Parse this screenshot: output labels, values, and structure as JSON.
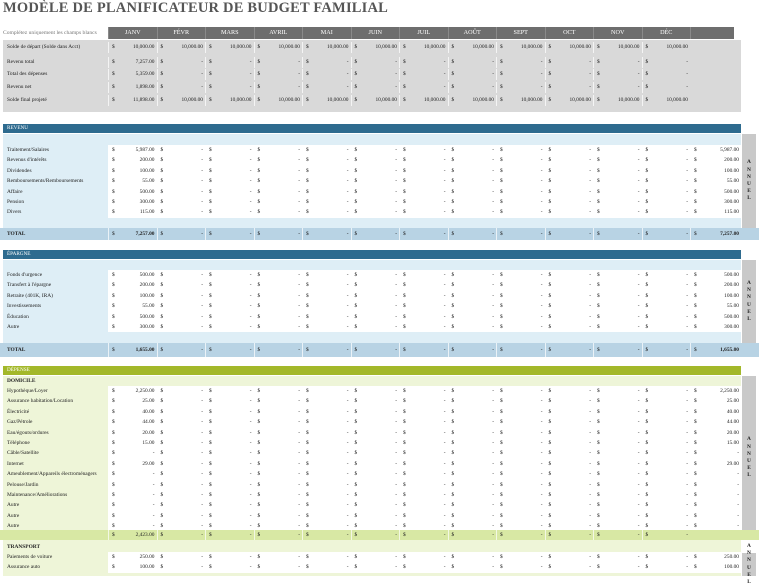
{
  "title": "MODÈLE DE PLANIFICATEUR DE BUDGET FAMILIAL",
  "hint": "Complétez uniquement les champs blancs",
  "months": [
    "JANV",
    "FÉVR",
    "MARS",
    "AVRIL",
    "MAI",
    "JUIN",
    "JUIL",
    "AOÛT",
    "SEPT",
    "OCT",
    "NOV",
    "DÉC"
  ],
  "currency": "$",
  "dash": "-",
  "annual_word": "ANNUEL",
  "summary": [
    {
      "label": "Solde de départ (Solde dans Acct)",
      "values": [
        "10,000.00",
        "10,000.00",
        "10,000.00",
        "10,000.00",
        "10,000.00",
        "10,000.00",
        "10,000.00",
        "10,000.00",
        "10,000.00",
        "10,000.00",
        "10,000.00",
        "10,000.00"
      ]
    },
    {
      "label": "Revenu total",
      "values": [
        "7,257.00",
        "-",
        "-",
        "-",
        "-",
        "-",
        "-",
        "-",
        "-",
        "-",
        "-",
        "-"
      ]
    },
    {
      "label": "Total des dépenses",
      "values": [
        "5,359.00",
        "-",
        "-",
        "-",
        "-",
        "-",
        "-",
        "-",
        "-",
        "-",
        "-",
        "-"
      ]
    },
    {
      "label": "Revenu net",
      "values": [
        "1,898.00",
        "-",
        "-",
        "-",
        "-",
        "-",
        "-",
        "-",
        "-",
        "-",
        "-",
        "-"
      ]
    },
    {
      "label": "Solde final projeté",
      "values": [
        "11,898.00",
        "10,000.00",
        "10,000.00",
        "10,000.00",
        "10,000.00",
        "10,000.00",
        "10,000.00",
        "10,000.00",
        "10,000.00",
        "10,000.00",
        "10,000.00",
        "10,000.00"
      ]
    }
  ],
  "revenu": {
    "header": "REVENU",
    "color": "#2e6b8f",
    "rows": [
      {
        "label": "Traitement/Salaires",
        "jan": "5,987.00",
        "annual": "5,987.00"
      },
      {
        "label": "Revenus d'intérêts",
        "jan": "200.00",
        "annual": "200.00"
      },
      {
        "label": "Dividendes",
        "jan": "100.00",
        "annual": "100.00"
      },
      {
        "label": "Remboursements/Remboursements",
        "jan": "55.00",
        "annual": "55.00"
      },
      {
        "label": "Affaire",
        "jan": "500.00",
        "annual": "500.00"
      },
      {
        "label": "Pension",
        "jan": "300.00",
        "annual": "300.00"
      },
      {
        "label": "Divers",
        "jan": "115.00",
        "annual": "115.00"
      }
    ],
    "total_label": "TOTAL",
    "total_jan": "7,257.00",
    "total_annual": "7,257.00"
  },
  "epargne": {
    "header": "ÉPARGNE",
    "color": "#2e6b8f",
    "rows": [
      {
        "label": "Fonds d'urgence",
        "jan": "500.00",
        "annual": "500.00"
      },
      {
        "label": "Transfert à l'épargne",
        "jan": "200.00",
        "annual": "200.00"
      },
      {
        "label": "Retraite (401K, IRA)",
        "jan": "100.00",
        "annual": "100.00"
      },
      {
        "label": "Investissements",
        "jan": "55.00",
        "annual": "55.00"
      },
      {
        "label": "Éducation",
        "jan": "500.00",
        "annual": "500.00"
      },
      {
        "label": "Autre",
        "jan": "300.00",
        "annual": "300.00"
      }
    ],
    "total_label": "TOTAL",
    "total_jan": "1,655.00",
    "total_annual": "1,655.00"
  },
  "depense": {
    "header": "DÉPENSE",
    "color": "#a3b82a",
    "domicile_label": "DOMICILE",
    "rows": [
      {
        "label": "Hypothèque/Loyer",
        "jan": "2,250.00",
        "annual": "2,250.00"
      },
      {
        "label": "Assurance habitation/Location",
        "jan": "25.00",
        "annual": "25.00"
      },
      {
        "label": "Électricité",
        "jan": "40.00",
        "annual": "40.00"
      },
      {
        "label": "Gaz/Pétrole",
        "jan": "44.00",
        "annual": "44.00"
      },
      {
        "label": "Eau/égouts/ordures",
        "jan": "20.00",
        "annual": "20.00"
      },
      {
        "label": "Téléphone",
        "jan": "15.00",
        "annual": "15.00"
      },
      {
        "label": "Câble/Satellite",
        "jan": "-",
        "annual": "-"
      },
      {
        "label": "Internet",
        "jan": "29.00",
        "annual": "29.00"
      },
      {
        "label": "Ameublement/Appareils électroménagers",
        "jan": "-",
        "annual": "-"
      },
      {
        "label": "Pelouse/Jardin",
        "jan": "-",
        "annual": "-"
      },
      {
        "label": "Maintenance/Améliorations",
        "jan": "-",
        "annual": "-"
      },
      {
        "label": "Autre",
        "jan": "-",
        "annual": "-"
      },
      {
        "label": "Autre",
        "jan": "-",
        "annual": "-"
      },
      {
        "label": "Autre",
        "jan": "-",
        "annual": "-"
      }
    ],
    "domicile_total_jan": "2,423.00",
    "transport_label": "TRANSPORT",
    "transport_rows": [
      {
        "label": "Paiements de voiture",
        "jan": "250.00",
        "annual": "250.00"
      },
      {
        "label": "Assurance auto",
        "jan": "100.00",
        "annual": "100.00"
      }
    ]
  }
}
